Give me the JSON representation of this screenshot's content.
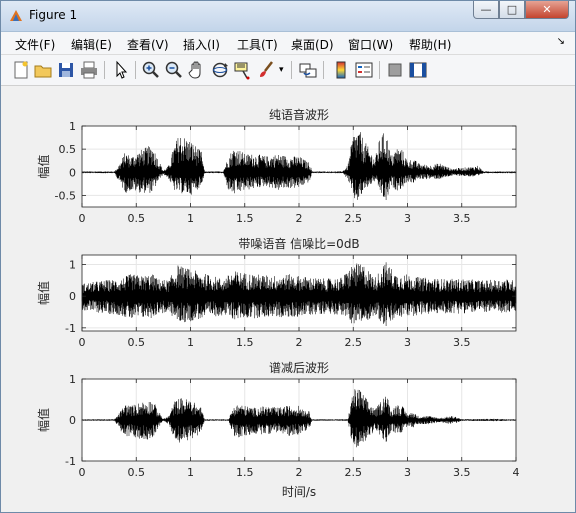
{
  "window": {
    "title": "Figure 1"
  },
  "menu": [
    "文件(F)",
    "编辑(E)",
    "查看(V)",
    "插入(I)",
    "工具(T)",
    "桌面(D)",
    "窗口(W)",
    "帮助(H)"
  ],
  "toolbar": [
    "new-figure-icon",
    "open-file-icon",
    "save-icon",
    "print-icon",
    "pointer-icon",
    "zoom-in-icon",
    "zoom-out-icon",
    "pan-icon",
    "rotate-3d-icon",
    "data-cursor-icon",
    "brush-icon",
    "link-plot-icon",
    "colorbar-icon",
    "legend-icon",
    "hide-plot-tools-icon",
    "show-plot-tools-icon"
  ],
  "chart_data": [
    {
      "type": "line",
      "title": "纯语音波形",
      "xlabel": "",
      "ylabel": "幅值",
      "xlim": [
        0,
        4
      ],
      "ylim": [
        -0.75,
        1
      ],
      "xticks": [
        "0",
        "0.5",
        "1",
        "1.5",
        "2",
        "2.5",
        "3",
        "3.5"
      ],
      "yticks": [
        "1",
        "0.5",
        "0",
        "-0.5"
      ],
      "grid": true,
      "envelope": {
        "x": [
          0,
          0.3,
          0.35,
          0.4,
          0.45,
          0.55,
          0.65,
          0.7,
          0.75,
          0.8,
          0.85,
          0.9,
          1.0,
          1.1,
          1.13,
          1.3,
          1.35,
          1.4,
          1.45,
          1.5,
          1.6,
          1.7,
          1.8,
          1.9,
          2.0,
          2.1,
          2.12,
          2.4,
          2.45,
          2.5,
          2.55,
          2.6,
          2.7,
          2.75,
          2.8,
          2.85,
          2.9,
          2.95,
          3.0,
          3.05,
          3.1,
          3.2,
          3.3,
          3.4,
          3.5,
          3.6,
          3.65,
          3.7,
          4.0
        ],
        "upper": [
          0.02,
          0.02,
          0.2,
          0.45,
          0.35,
          0.5,
          0.6,
          0.3,
          0.04,
          0.15,
          0.6,
          0.85,
          0.7,
          0.45,
          0.02,
          0.02,
          0.35,
          0.55,
          0.5,
          0.4,
          0.4,
          0.35,
          0.4,
          0.35,
          0.35,
          0.2,
          0.02,
          0.02,
          0.15,
          0.85,
          0.95,
          0.7,
          0.3,
          0.8,
          0.9,
          0.35,
          0.55,
          0.5,
          0.25,
          0.3,
          0.2,
          0.15,
          0.2,
          0.08,
          0.1,
          0.12,
          0.15,
          0.02,
          0.02
        ],
        "lower": [
          -0.02,
          -0.02,
          -0.25,
          -0.45,
          -0.4,
          -0.45,
          -0.45,
          -0.2,
          -0.04,
          -0.15,
          -0.4,
          -0.45,
          -0.5,
          -0.3,
          -0.02,
          -0.02,
          -0.4,
          -0.5,
          -0.45,
          -0.4,
          -0.35,
          -0.3,
          -0.4,
          -0.35,
          -0.35,
          -0.2,
          -0.02,
          -0.02,
          -0.15,
          -0.6,
          -0.65,
          -0.4,
          -0.2,
          -0.45,
          -0.7,
          -0.3,
          -0.4,
          -0.35,
          -0.2,
          -0.25,
          -0.15,
          -0.15,
          -0.15,
          -0.08,
          -0.08,
          -0.1,
          -0.1,
          -0.02,
          -0.02
        ]
      }
    },
    {
      "type": "line",
      "title": "带噪语音 信噪比=0dB",
      "xlabel": "",
      "ylabel": "幅值",
      "xlim": [
        0,
        4
      ],
      "ylim": [
        -1.1,
        1.3
      ],
      "xticks": [
        "0",
        "0.5",
        "1",
        "1.5",
        "2",
        "2.5",
        "3",
        "3.5"
      ],
      "yticks": [
        "1",
        "0",
        "-1"
      ],
      "grid": true,
      "envelope": {
        "x": [
          0,
          0.2,
          0.35,
          0.45,
          0.55,
          0.65,
          0.7,
          0.8,
          0.88,
          0.95,
          1.05,
          1.15,
          1.3,
          1.4,
          1.5,
          1.6,
          1.75,
          1.9,
          2.0,
          2.1,
          2.25,
          2.4,
          2.5,
          2.6,
          2.7,
          2.8,
          2.9,
          3.0,
          3.1,
          3.3,
          3.5,
          3.7,
          3.9,
          4.0
        ],
        "upper": [
          0.4,
          0.5,
          0.55,
          0.7,
          0.65,
          0.7,
          0.55,
          0.5,
          1.0,
          0.9,
          0.8,
          0.7,
          0.55,
          0.8,
          0.75,
          0.7,
          0.65,
          0.7,
          0.65,
          0.6,
          0.55,
          0.6,
          1.05,
          1.0,
          0.6,
          1.1,
          0.7,
          0.7,
          0.6,
          0.55,
          0.55,
          0.5,
          0.55,
          0.5
        ],
        "lower": [
          -0.45,
          -0.55,
          -0.6,
          -0.75,
          -0.7,
          -0.7,
          -0.55,
          -0.55,
          -0.8,
          -0.85,
          -0.75,
          -0.7,
          -0.6,
          -0.75,
          -0.7,
          -0.7,
          -0.65,
          -0.7,
          -0.65,
          -0.6,
          -0.55,
          -0.6,
          -0.9,
          -0.85,
          -0.6,
          -1.0,
          -0.7,
          -0.65,
          -0.6,
          -0.55,
          -0.55,
          -0.5,
          -0.55,
          -0.5
        ]
      }
    },
    {
      "type": "line",
      "title": "谱减后波形",
      "xlabel": "时间/s",
      "ylabel": "幅值",
      "xlim": [
        0,
        4
      ],
      "ylim": [
        -1,
        1
      ],
      "xticks": [
        "0",
        "0.5",
        "1",
        "1.5",
        "2",
        "2.5",
        "3",
        "3.5",
        "4"
      ],
      "yticks": [
        "1",
        "0",
        "-1"
      ],
      "grid": true,
      "envelope": {
        "x": [
          0,
          0.3,
          0.35,
          0.4,
          0.45,
          0.55,
          0.65,
          0.7,
          0.75,
          0.8,
          0.85,
          0.9,
          1.0,
          1.1,
          1.13,
          1.35,
          1.4,
          1.45,
          1.5,
          1.6,
          1.7,
          1.8,
          1.9,
          2.0,
          2.1,
          2.12,
          2.45,
          2.5,
          2.55,
          2.6,
          2.7,
          2.75,
          2.8,
          2.85,
          2.9,
          2.95,
          3.0,
          3.05,
          3.1,
          3.2,
          3.3,
          3.4,
          3.45,
          3.5,
          3.8,
          4.0
        ],
        "upper": [
          0.02,
          0.02,
          0.2,
          0.4,
          0.35,
          0.45,
          0.5,
          0.25,
          0.03,
          0.1,
          0.45,
          0.55,
          0.5,
          0.3,
          0.02,
          0.02,
          0.35,
          0.4,
          0.35,
          0.3,
          0.35,
          0.3,
          0.35,
          0.35,
          0.2,
          0.02,
          0.02,
          0.75,
          0.8,
          0.6,
          0.25,
          0.45,
          0.7,
          0.25,
          0.4,
          0.35,
          0.15,
          0.2,
          0.1,
          0.1,
          0.05,
          0.1,
          0.08,
          0.02,
          0.03,
          0.02
        ],
        "lower": [
          -0.02,
          -0.02,
          -0.25,
          -0.45,
          -0.4,
          -0.5,
          -0.45,
          -0.2,
          -0.03,
          -0.1,
          -0.45,
          -0.55,
          -0.5,
          -0.3,
          -0.02,
          -0.02,
          -0.4,
          -0.45,
          -0.4,
          -0.35,
          -0.35,
          -0.3,
          -0.4,
          -0.35,
          -0.2,
          -0.02,
          -0.02,
          -0.7,
          -0.75,
          -0.55,
          -0.25,
          -0.4,
          -0.6,
          -0.25,
          -0.35,
          -0.3,
          -0.15,
          -0.2,
          -0.1,
          -0.1,
          -0.05,
          -0.1,
          -0.08,
          -0.02,
          -0.03,
          -0.02
        ]
      }
    }
  ]
}
